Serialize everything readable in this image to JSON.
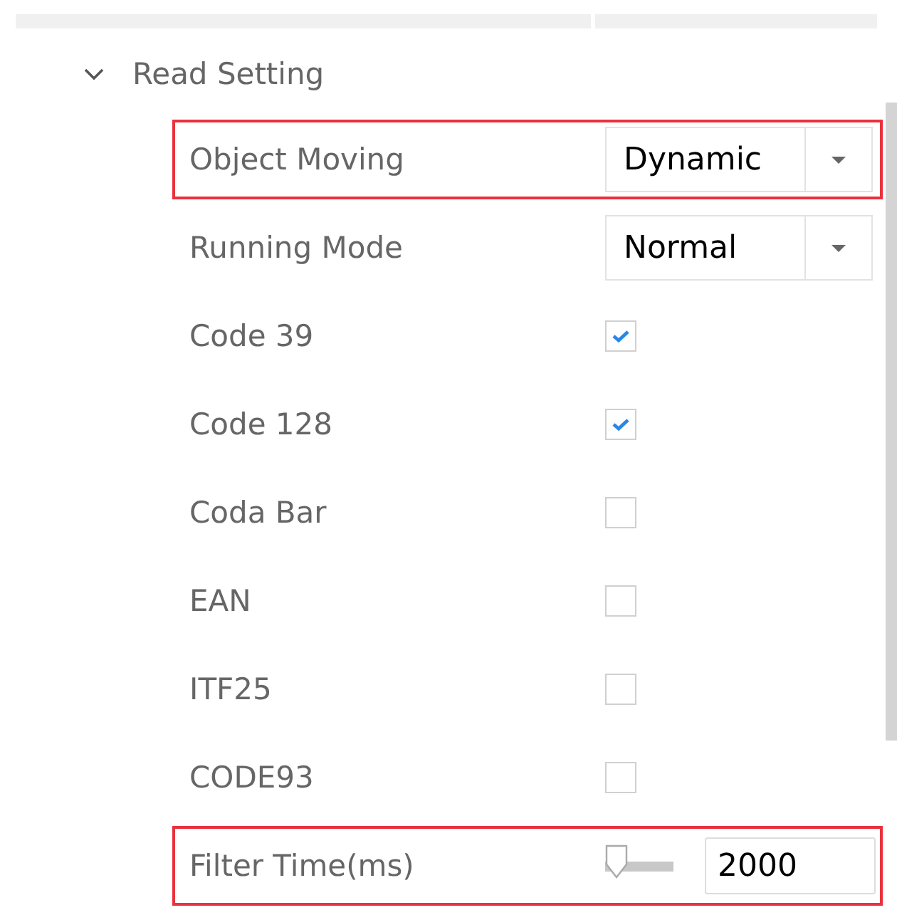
{
  "section": {
    "title": "Read Setting",
    "expanded": true
  },
  "rows": [
    {
      "kind": "dropdown",
      "label": "Object Moving",
      "value": "Dynamic",
      "highlighted": true
    },
    {
      "kind": "dropdown",
      "label": "Running Mode",
      "value": "Normal",
      "highlighted": false
    },
    {
      "kind": "checkbox",
      "label": "Code 39",
      "checked": true,
      "highlighted": false
    },
    {
      "kind": "checkbox",
      "label": "Code 128",
      "checked": true,
      "highlighted": false
    },
    {
      "kind": "checkbox",
      "label": "Coda Bar",
      "checked": false,
      "highlighted": false
    },
    {
      "kind": "checkbox",
      "label": "EAN",
      "checked": false,
      "highlighted": false
    },
    {
      "kind": "checkbox",
      "label": "ITF25",
      "checked": false,
      "highlighted": false
    },
    {
      "kind": "checkbox",
      "label": "CODE93",
      "checked": false,
      "highlighted": false
    },
    {
      "kind": "slider",
      "label": "Filter Time(ms)",
      "level": 0,
      "value": "2000",
      "highlighted": true
    }
  ]
}
